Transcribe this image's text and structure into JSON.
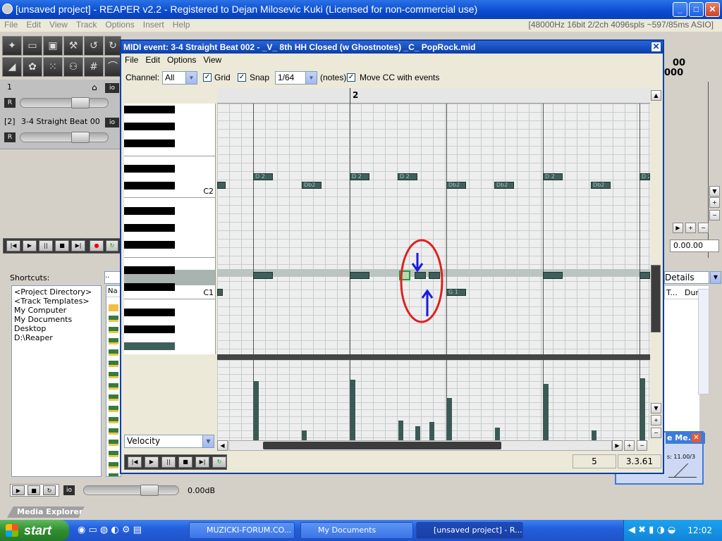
{
  "app": {
    "title": "[unsaved project] - REAPER v2.2 - Registered to Dejan Milosevic Kuki (Licensed for non-commercial use)",
    "menu": [
      "File",
      "Edit",
      "View",
      "Track",
      "Options",
      "Insert",
      "Help"
    ],
    "status": "[48000Hz 16bit 2/2ch 4096spls ~597/85ms ASIO]"
  },
  "tracks": [
    {
      "num": "1",
      "name": "",
      "r": "R",
      "io": "io"
    },
    {
      "num": "[2]",
      "name": "3-4 Straight Beat 00",
      "r": "R",
      "io": "io"
    }
  ],
  "shortcuts": {
    "label": "Shortcuts:",
    "items": [
      "<Project Directory>",
      "<Track Templates>",
      "My Computer",
      "My Documents",
      "Desktop",
      "D:\\Reaper"
    ],
    "col_name": "Na",
    "volume": "0.00dB",
    "io": "io",
    "tab": "Media Explorer"
  },
  "midi": {
    "title": "MIDI event: 3-4 Straight Beat 002 - _V_ 8th HH Closed (w Ghostnotes) _C_ PopRock.mid",
    "menu": [
      "File",
      "Edit",
      "Options",
      "View"
    ],
    "channel_label": "Channel:",
    "channel_value": "All",
    "grid_label": "Grid",
    "snap_label": "Snap",
    "snap_value": "1/64",
    "notes_label": "(notes)",
    "movecc_label": "Move CC with events",
    "ruler_mark": "2",
    "key_c2": "C2",
    "key_c1": "C1",
    "note_label": "Db2",
    "note_label_b": "D 2",
    "note_label_g": "G 1",
    "lane_select": "Velocity",
    "pos_a": "5",
    "pos_b": "3.3.61"
  },
  "right": {
    "ruler_a": "00",
    "ruler_b": "000",
    "time": "0.00.00",
    "details": "Details",
    "col_t": "T...",
    "col_dur": "Dura",
    "perf_title": "e Me...",
    "perf_text": "s: 11.00/3"
  },
  "taskbar": {
    "start": "start",
    "tasks": [
      "MUZICKI-FORUM.CO...",
      "My Documents",
      "[unsaved project] - R..."
    ],
    "clock": "12:02"
  },
  "colors": {
    "accent": "#0a4bd0",
    "note": "#3f5f5a",
    "annotation": "#e02020",
    "arrow": "#1a1ae0"
  }
}
